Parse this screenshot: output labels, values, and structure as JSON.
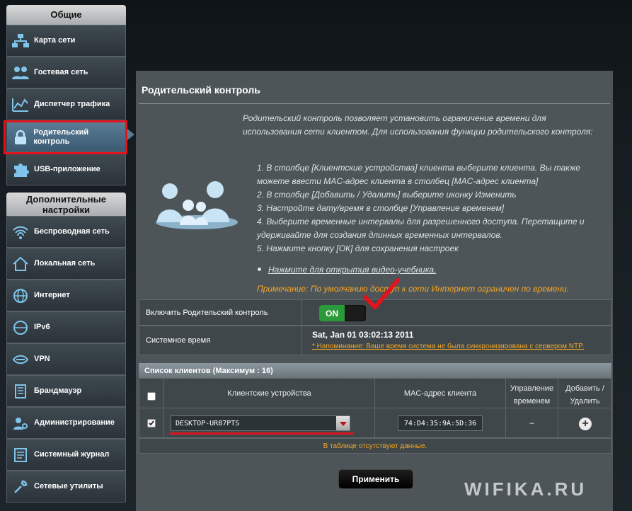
{
  "sidebar": {
    "general_header": "Общие",
    "general_items": [
      {
        "label": "Карта сети",
        "icon": "network-map-icon"
      },
      {
        "label": "Гостевая сеть",
        "icon": "guest-network-icon"
      },
      {
        "label": "Диспетчер трафика",
        "icon": "traffic-manager-icon"
      },
      {
        "label": "Родительский контроль",
        "icon": "lock-icon",
        "active": true
      },
      {
        "label": "USB-приложение",
        "icon": "puzzle-icon"
      }
    ],
    "advanced_header": "Дополнительные настройки",
    "advanced_items": [
      {
        "label": "Беспроводная сеть",
        "icon": "wireless-icon"
      },
      {
        "label": "Локальная сеть",
        "icon": "home-icon"
      },
      {
        "label": "Интернет",
        "icon": "globe-icon"
      },
      {
        "label": "IPv6",
        "icon": "ipv6-icon"
      },
      {
        "label": "VPN",
        "icon": "vpn-icon"
      },
      {
        "label": "Брандмауэр",
        "icon": "firewall-icon"
      },
      {
        "label": "Администрирование",
        "icon": "admin-icon"
      },
      {
        "label": "Системный журнал",
        "icon": "log-icon"
      },
      {
        "label": "Сетевые утилиты",
        "icon": "tools-icon"
      }
    ]
  },
  "panel": {
    "title": "Родительский контроль",
    "description": "Родительский контроль позволяет установить ограничение времени для использования сети клиентом. Для использования функции родительского контроля:",
    "steps": [
      "1. В столбце [Клиентские устройства] клиента выберите клиента. Вы также можете ввести MAC-адрес клиента в столбец [MAC-адрес клиента]",
      "2. В столбце [Добавить / Удалить] выберите иконку Изменить",
      "3. Настройте дату/время в столбце [Управление временем]",
      "4. Выберите временные интервалы для разрешенного доступа. Перетащите и удерживайте для создания длинных временных интервалов.",
      "5. Нажмите кнопку [ОК] для сохранения настроек"
    ],
    "video_link": "Нажмите для открытия видео-учебника.",
    "note": "Примечание: По умолчанию доступ к сети Интернет ограничен по времени.",
    "enable_label": "Включить Родительский контроль",
    "toggle_state": "ON",
    "system_time_label": "Системное время",
    "system_time_value": "Sat, Jan 01 03:02:13 2011",
    "system_time_warning": "* Напоминание: Ваше время система не была синхронизирована с сервером NTP."
  },
  "client_table": {
    "title": "Список клиентов (Максимум : 16)",
    "columns": [
      "Клиентские устройства",
      "MAC-адрес клиента",
      "Управление временем",
      "Добавить / Удалить"
    ],
    "row": {
      "device": "DESKTOP-UR87PTS",
      "mac": "74:D4:35:9A:5D:36",
      "time_control": "–"
    },
    "empty_message": "В таблице отсутствуют данные."
  },
  "apply_label": "Применить",
  "watermark": "WIFIKA.RU",
  "colors": {
    "highlight": "#e3131e",
    "warning": "#f5a623",
    "toggle_on": "#2b9a3a"
  }
}
